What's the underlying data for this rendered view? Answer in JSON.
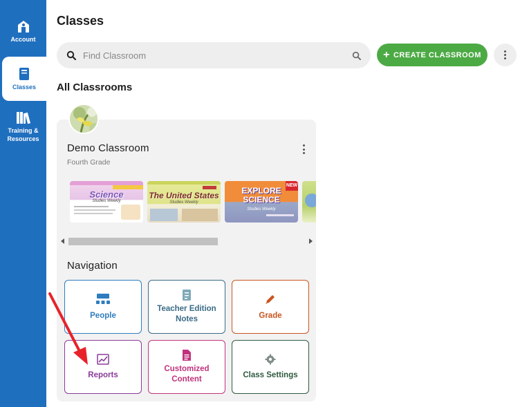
{
  "sidebar": {
    "items": [
      {
        "label": "Account",
        "icon": "account-icon"
      },
      {
        "label": "Classes",
        "icon": "book-icon",
        "active": true
      },
      {
        "label": "Training & Resources",
        "icon": "books-icon"
      }
    ]
  },
  "page": {
    "title": "Classes"
  },
  "search": {
    "placeholder": "Find Classroom",
    "value": ""
  },
  "toolbar": {
    "create_label": "CREATE CLASSROOM",
    "create_icon": "plus-icon"
  },
  "section": {
    "title": "All Classrooms"
  },
  "classroom": {
    "name": "Demo Classroom",
    "grade": "Fourth Grade",
    "books": [
      {
        "title": "Science",
        "subtitle": "Studies Weekly",
        "theme": "science-weekly"
      },
      {
        "title": "The United States",
        "subtitle": "Studies Weekly",
        "theme": "us-weekly"
      },
      {
        "title": "EXPLORE SCIENCE",
        "subtitle": "Studies Weekly",
        "badge": "NEW",
        "theme": "explore-science"
      },
      {
        "title": "",
        "subtitle": "",
        "theme": "partial"
      }
    ],
    "navigation_title": "Navigation",
    "navigation": [
      {
        "label": "People",
        "icon": "people-icon",
        "color": "#2f7dbf"
      },
      {
        "label": "Teacher Edition Notes",
        "icon": "notes-icon",
        "color": "#3a6b85"
      },
      {
        "label": "Grade",
        "icon": "pencil-icon",
        "color": "#c9541f"
      },
      {
        "label": "Reports",
        "icon": "chart-icon",
        "color": "#8a3a9a"
      },
      {
        "label": "Customized Content",
        "icon": "document-icon",
        "color": "#c0327c"
      },
      {
        "label": "Class Settings",
        "icon": "gear-icon",
        "color": "#2f5a3f"
      }
    ]
  },
  "colors": {
    "sidebar": "#1f6fbf",
    "create_button": "#4caa44",
    "annotation_arrow": "#e8222a"
  }
}
